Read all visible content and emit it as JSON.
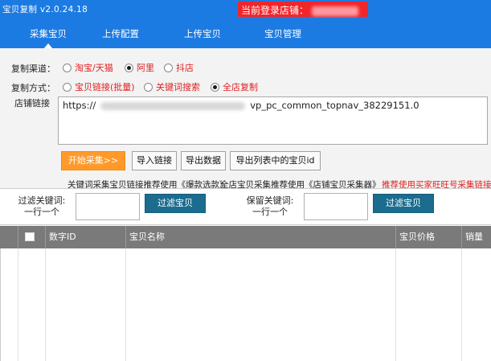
{
  "app": {
    "title": "宝贝复制 v2.0.24.18"
  },
  "store": {
    "label": "当前登录店铺："
  },
  "nav": {
    "tabs": [
      {
        "label": "采集宝贝",
        "active": true
      },
      {
        "label": "上传配置",
        "active": false
      },
      {
        "label": "上传宝贝",
        "active": false
      },
      {
        "label": "宝贝管理",
        "active": false
      }
    ]
  },
  "form": {
    "channel_label": "复制渠道：",
    "channels": [
      {
        "label": "淘宝/天猫",
        "checked": false
      },
      {
        "label": "阿里",
        "checked": true
      },
      {
        "label": "抖店",
        "checked": false
      }
    ],
    "method_label": "复制方式：",
    "methods": [
      {
        "label": "宝贝链接(批量)",
        "checked": false
      },
      {
        "label": "关键词搜索",
        "checked": false
      },
      {
        "label": "全店复制",
        "checked": true
      }
    ],
    "store_link_label": "店铺链接",
    "url_prefix": "https://",
    "url_suffix": "vp_pc_common_topnav_38229151.0"
  },
  "toolbar": {
    "start": "开始采集>>",
    "import": "导入链接",
    "export": "导出数据",
    "export_ids": "导出列表中的宝贝id"
  },
  "tips": {
    "keyword_tip": "关键词采集宝贝链接推荐使用《爆款选款》",
    "store_tip": "全店宝贝采集推荐使用《店铺宝贝采集器》",
    "buyer_tip": "推荐使用买家旺旺号采集链接"
  },
  "filter": {
    "exclude_label_1": "过滤关键词:",
    "exclude_label_2": "一行一个",
    "exclude_button": "过滤宝贝",
    "keep_label_1": "保留关键词:",
    "keep_label_2": "一行一个",
    "keep_button": "过滤宝贝"
  },
  "grid": {
    "columns": [
      "数字ID",
      "宝贝名称",
      "宝贝价格",
      "销量"
    ]
  },
  "colors": {
    "titlebar": "#1c7be3",
    "store_badge": "#f1262a",
    "start_button": "#ff9a2a",
    "filter_button": "#1b6c8f",
    "grid_header": "#7a7a7a"
  }
}
